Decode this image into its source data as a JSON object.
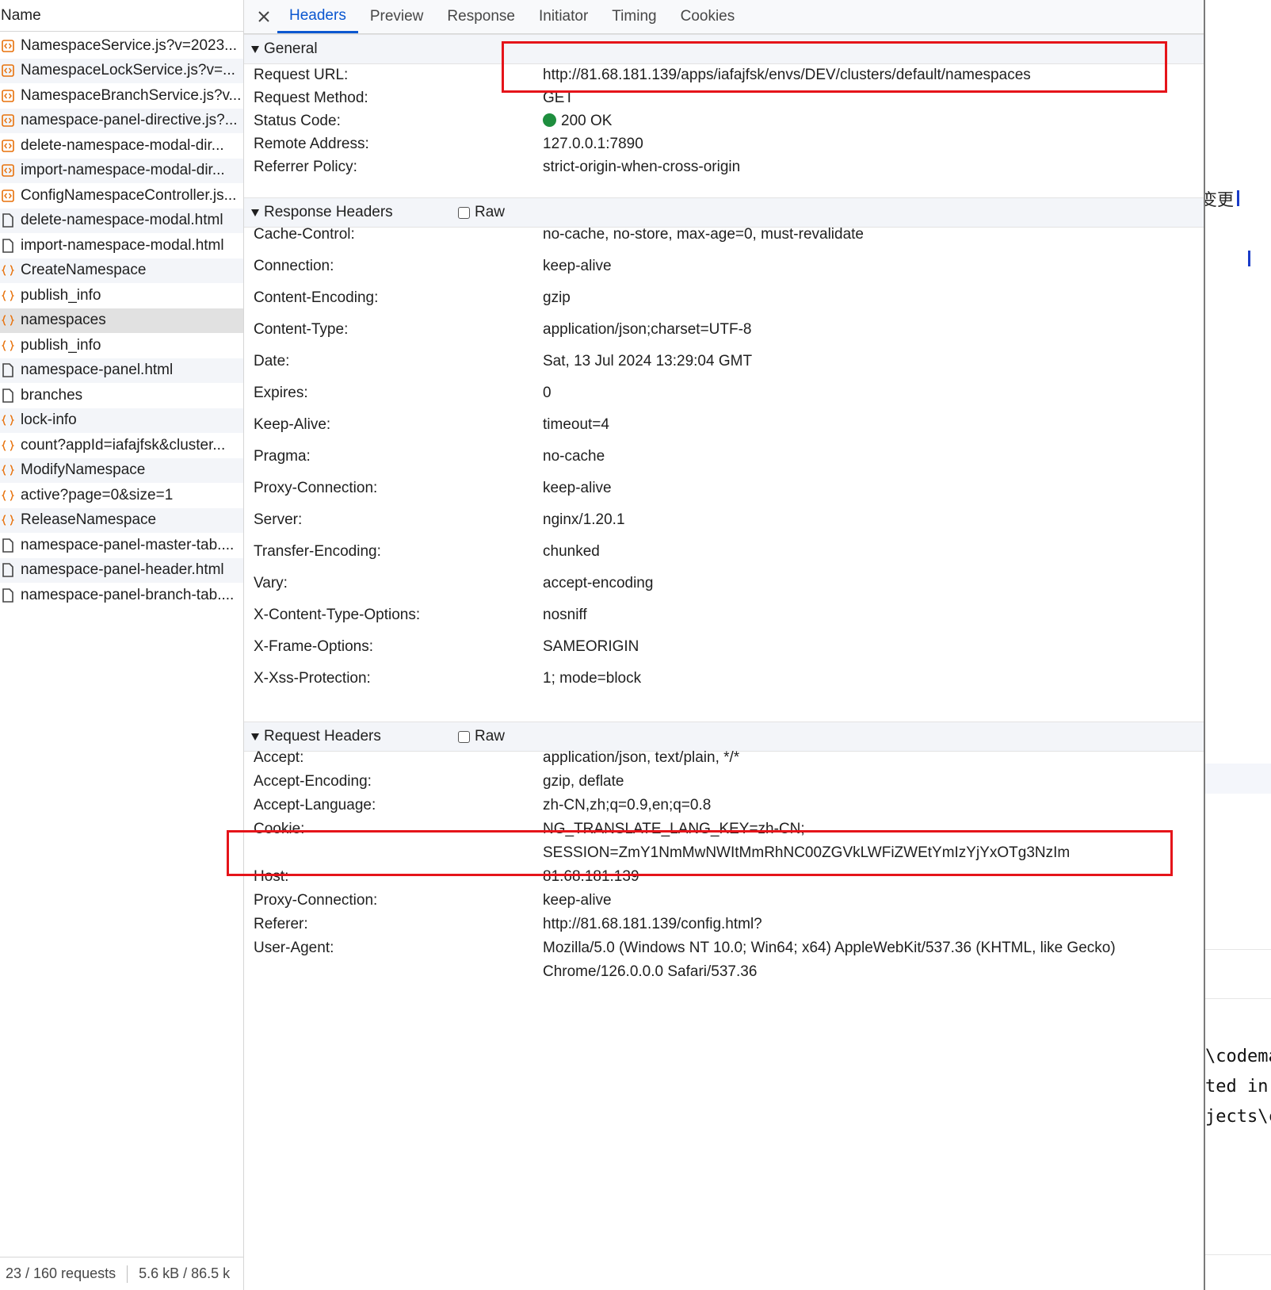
{
  "left_panel": {
    "column_header": "Name",
    "requests": [
      {
        "name": "NamespaceService.js?v=2023...",
        "type": "script"
      },
      {
        "name": "NamespaceLockService.js?v=...",
        "type": "script"
      },
      {
        "name": "NamespaceBranchService.js?v...",
        "type": "script"
      },
      {
        "name": "namespace-panel-directive.js?...",
        "type": "script"
      },
      {
        "name": "delete-namespace-modal-dir...",
        "type": "script"
      },
      {
        "name": "import-namespace-modal-dir...",
        "type": "script"
      },
      {
        "name": "ConfigNamespaceController.js...",
        "type": "script"
      },
      {
        "name": "delete-namespace-modal.html",
        "type": "document"
      },
      {
        "name": "import-namespace-modal.html",
        "type": "document"
      },
      {
        "name": "CreateNamespace",
        "type": "fetch"
      },
      {
        "name": "publish_info",
        "type": "fetch"
      },
      {
        "name": "namespaces",
        "type": "fetch",
        "selected": true
      },
      {
        "name": "publish_info",
        "type": "fetch"
      },
      {
        "name": "namespace-panel.html",
        "type": "document"
      },
      {
        "name": "branches",
        "type": "document"
      },
      {
        "name": "lock-info",
        "type": "fetch"
      },
      {
        "name": "count?appId=iafajfsk&cluster...",
        "type": "fetch"
      },
      {
        "name": "ModifyNamespace",
        "type": "fetch"
      },
      {
        "name": "active?page=0&size=1",
        "type": "fetch"
      },
      {
        "name": "ReleaseNamespace",
        "type": "fetch"
      },
      {
        "name": "namespace-panel-master-tab....",
        "type": "document"
      },
      {
        "name": "namespace-panel-header.html",
        "type": "document"
      },
      {
        "name": "namespace-panel-branch-tab....",
        "type": "document"
      }
    ],
    "footer": {
      "requests": "23 / 160 requests",
      "transferred": "5.6 kB / 86.5 k"
    }
  },
  "tabs": [
    "Headers",
    "Preview",
    "Response",
    "Initiator",
    "Timing",
    "Cookies"
  ],
  "active_tab": "Headers",
  "general": {
    "title": "General",
    "rows": [
      {
        "key": "Request URL:",
        "value": "http://81.68.181.139/apps/iafajfsk/envs/DEV/clusters/default/namespaces"
      },
      {
        "key": "Request Method:",
        "value": "GET"
      },
      {
        "key": "Status Code:",
        "value": "200 OK"
      },
      {
        "key": "Remote Address:",
        "value": "127.0.0.1:7890"
      },
      {
        "key": "Referrer Policy:",
        "value": "strict-origin-when-cross-origin"
      }
    ]
  },
  "response_headers": {
    "title": "Response Headers",
    "raw_label": "Raw",
    "rows": [
      {
        "key": "Cache-Control:",
        "value": "no-cache, no-store, max-age=0, must-revalidate"
      },
      {
        "key": "Connection:",
        "value": "keep-alive"
      },
      {
        "key": "Content-Encoding:",
        "value": "gzip"
      },
      {
        "key": "Content-Type:",
        "value": "application/json;charset=UTF-8"
      },
      {
        "key": "Date:",
        "value": "Sat, 13 Jul 2024 13:29:04 GMT"
      },
      {
        "key": "Expires:",
        "value": "0"
      },
      {
        "key": "Keep-Alive:",
        "value": "timeout=4"
      },
      {
        "key": "Pragma:",
        "value": "no-cache"
      },
      {
        "key": "Proxy-Connection:",
        "value": "keep-alive"
      },
      {
        "key": "Server:",
        "value": "nginx/1.20.1"
      },
      {
        "key": "Transfer-Encoding:",
        "value": "chunked"
      },
      {
        "key": "Vary:",
        "value": "accept-encoding"
      },
      {
        "key": "X-Content-Type-Options:",
        "value": "nosniff"
      },
      {
        "key": "X-Frame-Options:",
        "value": "SAMEORIGIN"
      },
      {
        "key": "X-Xss-Protection:",
        "value": "1; mode=block"
      }
    ]
  },
  "request_headers": {
    "title": "Request Headers",
    "raw_label": "Raw",
    "rows": [
      {
        "key": "Accept:",
        "value": "application/json, text/plain, */*"
      },
      {
        "key": "Accept-Encoding:",
        "value": "gzip, deflate"
      },
      {
        "key": "Accept-Language:",
        "value": "zh-CN,zh;q=0.9,en;q=0.8"
      },
      {
        "key": "Cookie:",
        "value": "NG_TRANSLATE_LANG_KEY=zh-CN;"
      },
      {
        "key": "",
        "value": "SESSION=ZmY1NmMwNWItMmRhNC00ZGVkLWFiZWEtYmIzYjYxOTg3NzIm"
      },
      {
        "key": "Host:",
        "value": "81.68.181.139"
      },
      {
        "key": "Proxy-Connection:",
        "value": "keep-alive"
      },
      {
        "key": "Referer:",
        "value": "http://81.68.181.139/config.html?"
      },
      {
        "key": "User-Agent:",
        "value": "Mozilla/5.0 (Windows NT 10.0; Win64; x64) AppleWebKit/537.36 (KHTML, like Gecko)"
      },
      {
        "key": "",
        "value": "Chrome/126.0.0.0 Safari/537.36"
      }
    ]
  },
  "background_window": {
    "cjk_text": "变更",
    "code_lines": [
      "\\codema",
      "ted in",
      "jects\\c"
    ]
  },
  "colors": {
    "accent": "#0b57d0",
    "status_ok": "#1e8e3e",
    "highlight_box": "#e5141a",
    "script_icon": "#e8710a"
  }
}
